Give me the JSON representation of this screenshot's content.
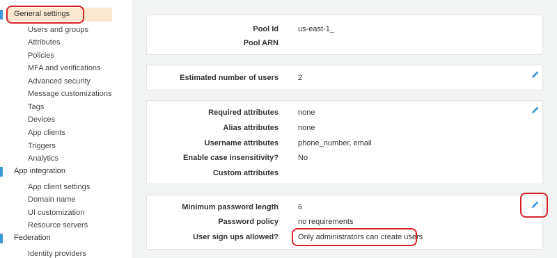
{
  "sidebar": {
    "sections": [
      {
        "label": "General settings",
        "items": [
          "Users and groups",
          "Attributes",
          "Policies",
          "MFA and verifications",
          "Advanced security",
          "Message customizations",
          "Tags",
          "Devices",
          "App clients",
          "Triggers",
          "Analytics"
        ]
      },
      {
        "label": "App integration",
        "items": [
          "App client settings",
          "Domain name",
          "UI customization",
          "Resource servers"
        ]
      },
      {
        "label": "Federation",
        "items": [
          "Identity providers"
        ]
      }
    ]
  },
  "cards": {
    "pool": {
      "pool_id_label": "Pool Id",
      "pool_id_value": "us-east-1_",
      "pool_arn_label": "Pool ARN",
      "pool_arn_value": ""
    },
    "users": {
      "estimated_label": "Estimated number of users",
      "estimated_value": "2"
    },
    "attributes": {
      "required_label": "Required attributes",
      "required_value": "none",
      "alias_label": "Alias attributes",
      "alias_value": "none",
      "username_label": "Username attributes",
      "username_value": "phone_number, email",
      "case_label": "Enable case insensitivity?",
      "case_value": "No",
      "custom_label": "Custom attributes",
      "custom_value": ""
    },
    "policies": {
      "minpw_label": "Minimum password length",
      "minpw_value": "6",
      "policy_label": "Password policy",
      "policy_value": "no requirements",
      "signup_label": "User sign ups allowed?",
      "signup_value": "Only administrators can create users"
    }
  },
  "icons": {
    "edit": "pencil-icon"
  },
  "colors": {
    "accent": "#3b99d9",
    "highlight": "#fbe6cf",
    "annotation": "#d9232a",
    "background": "#f2f3f3"
  }
}
